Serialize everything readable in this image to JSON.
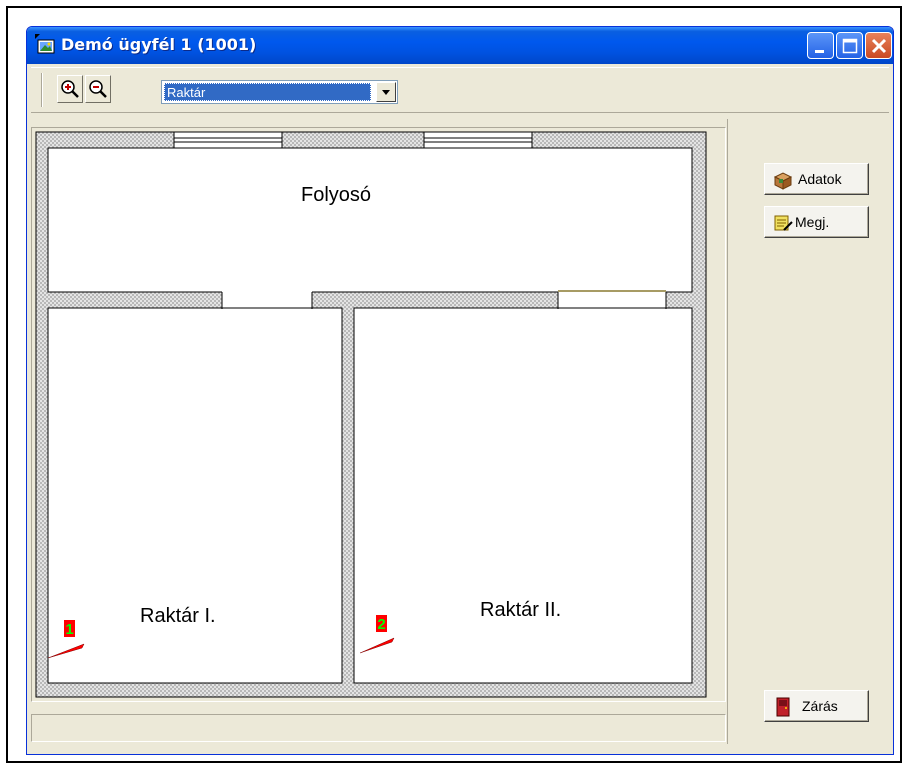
{
  "window": {
    "title": "Demó ügyfél 1 (1001)",
    "controls": [
      "minimize",
      "maximize",
      "close"
    ]
  },
  "toolbar": {
    "zoom_in_icon": "zoom-in-icon",
    "zoom_out_icon": "zoom-out-icon",
    "level_select": {
      "value": "Raktár"
    }
  },
  "floorplan": {
    "rooms": [
      {
        "name": "Folyosó"
      },
      {
        "name": "Raktár I."
      },
      {
        "name": "Raktár II."
      }
    ],
    "markers": [
      {
        "number": "1",
        "color": "#ff0000",
        "label_bg": "#ff0000",
        "label_fg": "#00ff00"
      },
      {
        "number": "2",
        "color": "#ff0000",
        "label_bg": "#ff0000",
        "label_fg": "#00ff00"
      }
    ]
  },
  "side_panel": {
    "data_button": "Adatok",
    "note_button": "Megj.",
    "close_button": "Zárás"
  },
  "colors": {
    "titlebar": "#0058ee",
    "window_bg": "#ece9d8",
    "selection": "#316ac5"
  }
}
